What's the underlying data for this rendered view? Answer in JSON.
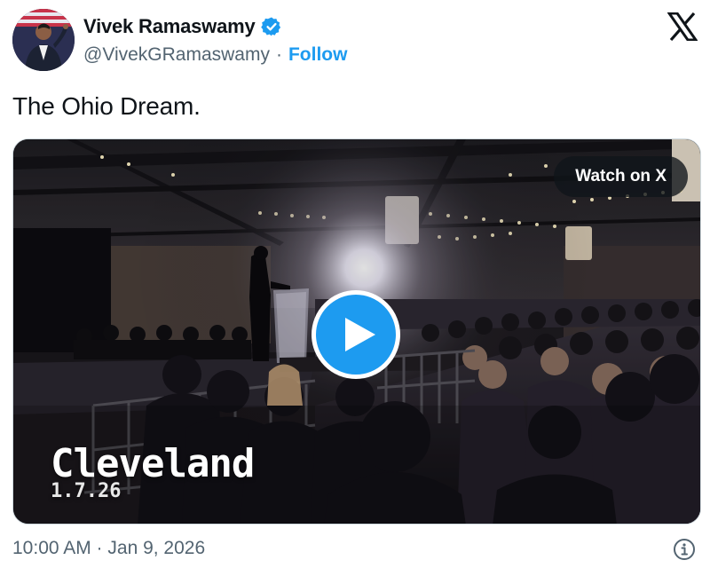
{
  "author": {
    "display_name": "Vivek Ramaswamy",
    "handle": "@VivekGRamaswamy",
    "separator": "·",
    "follow_label": "Follow",
    "verified": true,
    "avatar_icon": "profile-photo"
  },
  "brand": {
    "icon": "x-logo-icon"
  },
  "tweet": {
    "text": "The Ohio Dream."
  },
  "media": {
    "type": "video",
    "watch_label": "Watch on X",
    "play_icon": "play-icon",
    "overlay_title": "Cleveland",
    "overlay_date": "1.7.26"
  },
  "footer": {
    "timestamp": "10:00 AM · Jan 9, 2026",
    "info_icon": "info-icon"
  },
  "colors": {
    "accent": "#1d9bf0",
    "text_primary": "#0f1419",
    "text_secondary": "#536471"
  }
}
